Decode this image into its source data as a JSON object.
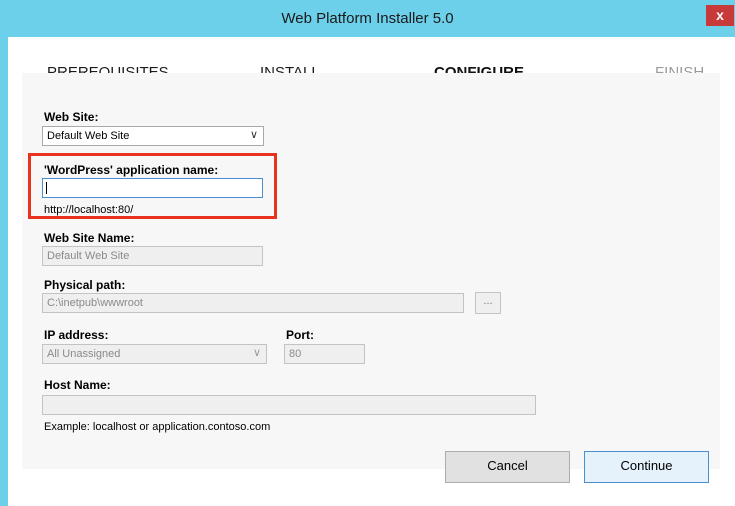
{
  "window": {
    "title": "Web Platform Installer 5.0",
    "close_glyph": "x"
  },
  "steps": [
    {
      "label": "PREREQUISITES",
      "state": "done"
    },
    {
      "label": "INSTALL",
      "state": "done"
    },
    {
      "label": "CONFIGURE",
      "state": "current"
    },
    {
      "label": "FINISH",
      "state": "pending"
    }
  ],
  "form": {
    "web_site": {
      "label": "Web Site:",
      "value": "Default Web Site"
    },
    "app_name": {
      "label": "'WordPress' application name:",
      "value": "",
      "url_preview": "http://localhost:80/"
    },
    "site_name": {
      "label": "Web Site Name:",
      "value": "Default Web Site"
    },
    "physical_path": {
      "label": "Physical path:",
      "value": "C:\\inetpub\\wwwroot",
      "browse_label": "..."
    },
    "ip_address": {
      "label": "IP address:",
      "value": "All Unassigned"
    },
    "port": {
      "label": "Port:",
      "value": "80"
    },
    "host_name": {
      "label": "Host Name:",
      "value": "",
      "example": "Example: localhost or application.contoso.com"
    }
  },
  "buttons": {
    "cancel": "Cancel",
    "continue": "Continue"
  },
  "colors": {
    "titlebar": "#6dd0eb",
    "highlight": "#e8321e",
    "progress_done": "#111111",
    "progress_pending": "#c6e6f3"
  }
}
